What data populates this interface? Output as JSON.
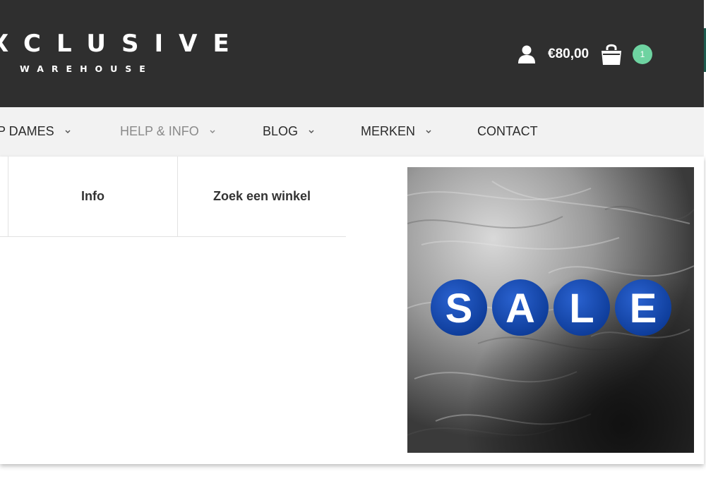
{
  "header": {
    "logo_main": "XCLUSIVE",
    "logo_sub": "WAREHOUSE",
    "account_icon": "user-icon",
    "cart_total": "€80,00",
    "cart_icon": "shopping-bag-icon",
    "cart_count": "1",
    "colors": {
      "background": "#2f2f2f",
      "badge": "#6ed3a1"
    }
  },
  "nav": {
    "items": [
      {
        "label": "P DAMES",
        "has_dropdown": true
      },
      {
        "label": "HELP & INFO",
        "has_dropdown": true,
        "active": true
      },
      {
        "label": "BLOG",
        "has_dropdown": true
      },
      {
        "label": "MERKEN",
        "has_dropdown": true
      },
      {
        "label": "CONTACT",
        "has_dropdown": false
      }
    ]
  },
  "dropdown": {
    "links": [
      {
        "label": "Info"
      },
      {
        "label": "Zoek een winkel"
      }
    ],
    "banner": {
      "letters": [
        "S",
        "A",
        "L",
        "E"
      ],
      "circle_color": "#1446a8"
    }
  }
}
